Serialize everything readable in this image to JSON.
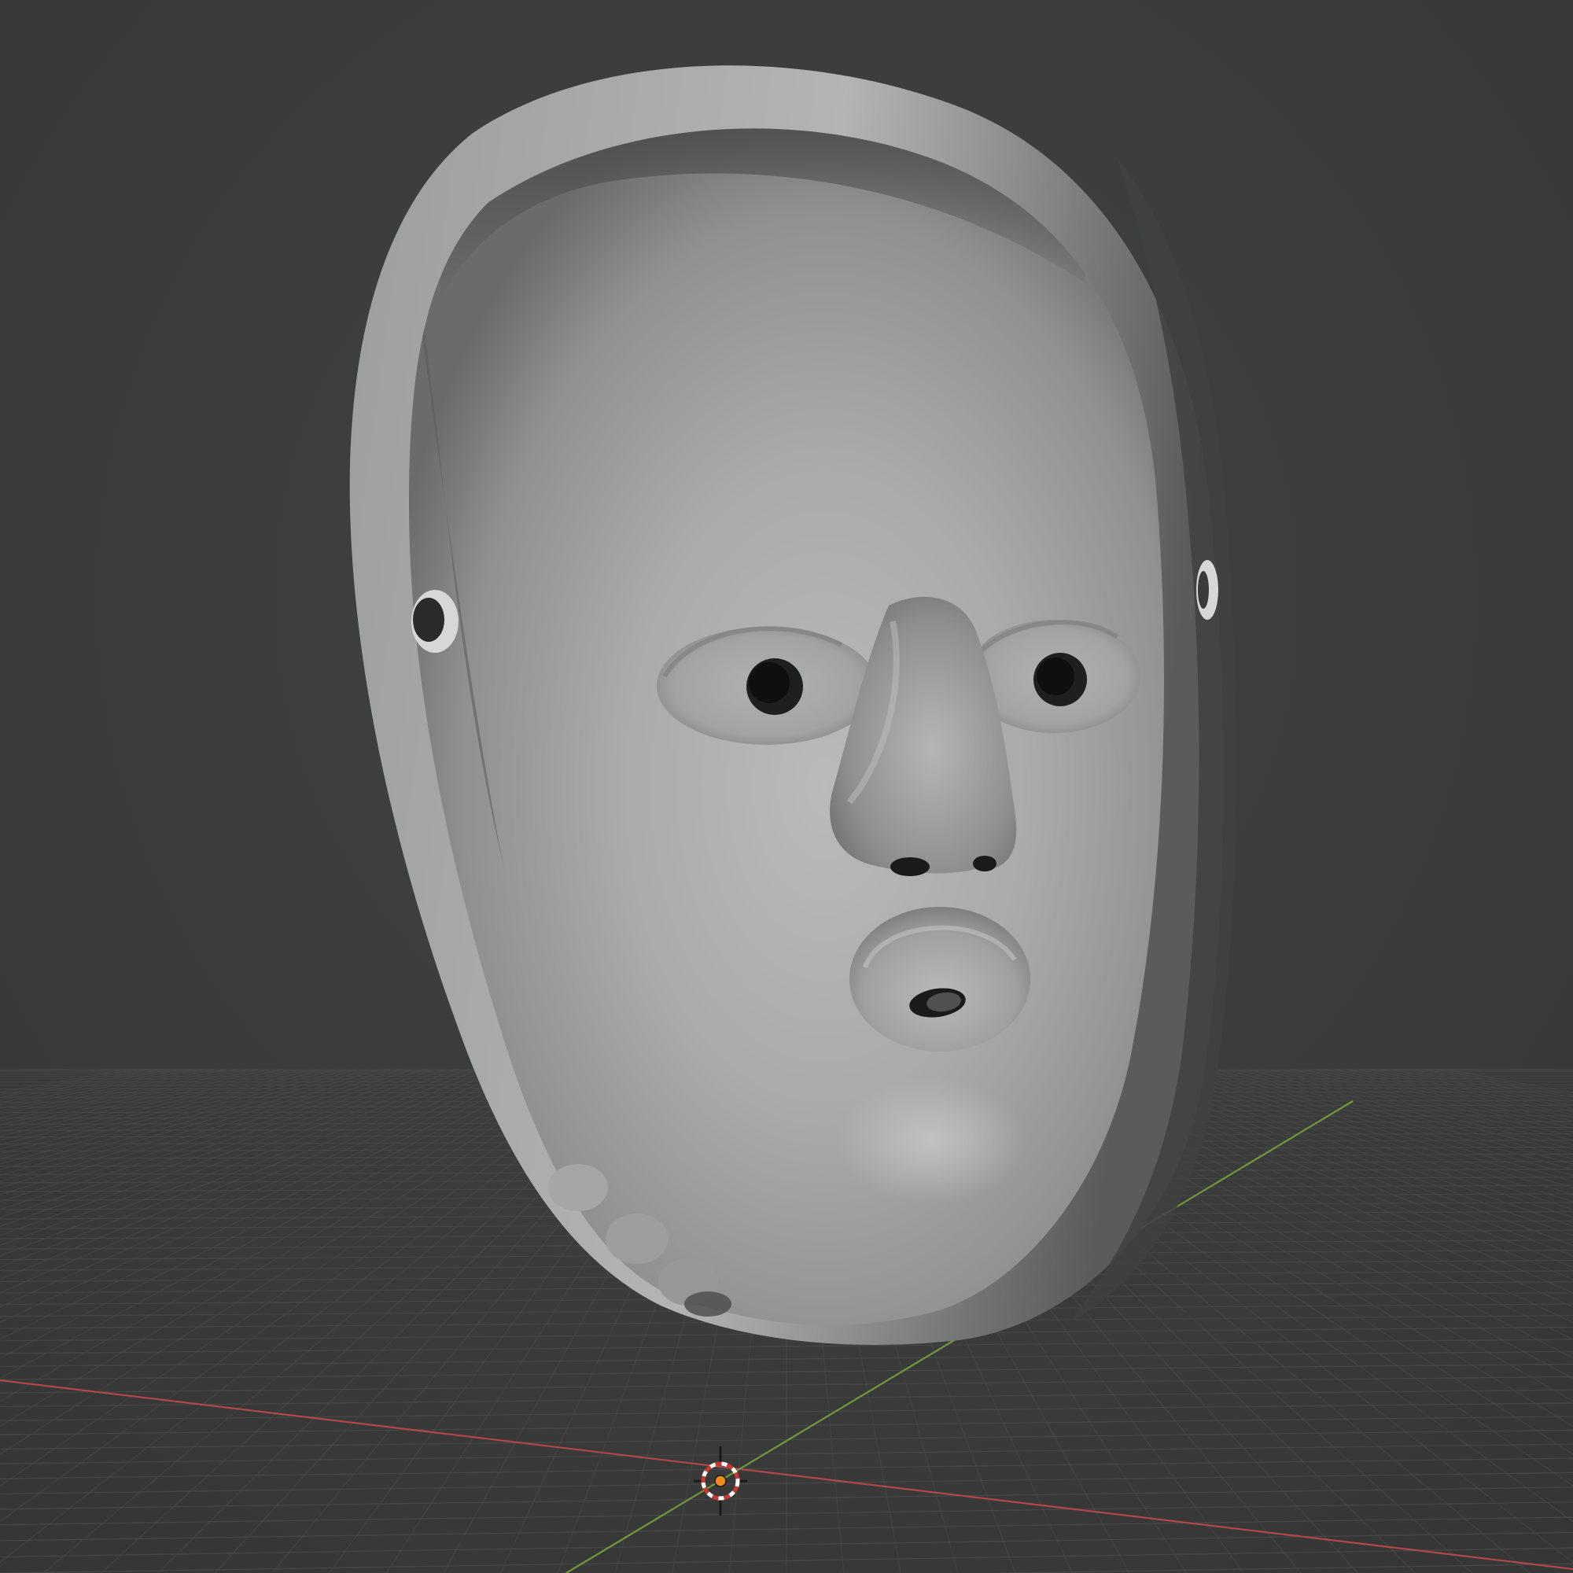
{
  "viewport": {
    "background_color": "#3c3c3c",
    "grid_color": "#4a4a4a",
    "x_axis_color": "#b04848",
    "y_axis_color": "#6f9a3a",
    "mask_color": "#a7a9a9",
    "cursor_icon": "3d-cursor-icon",
    "origin_icon": "origin-dot-icon"
  }
}
